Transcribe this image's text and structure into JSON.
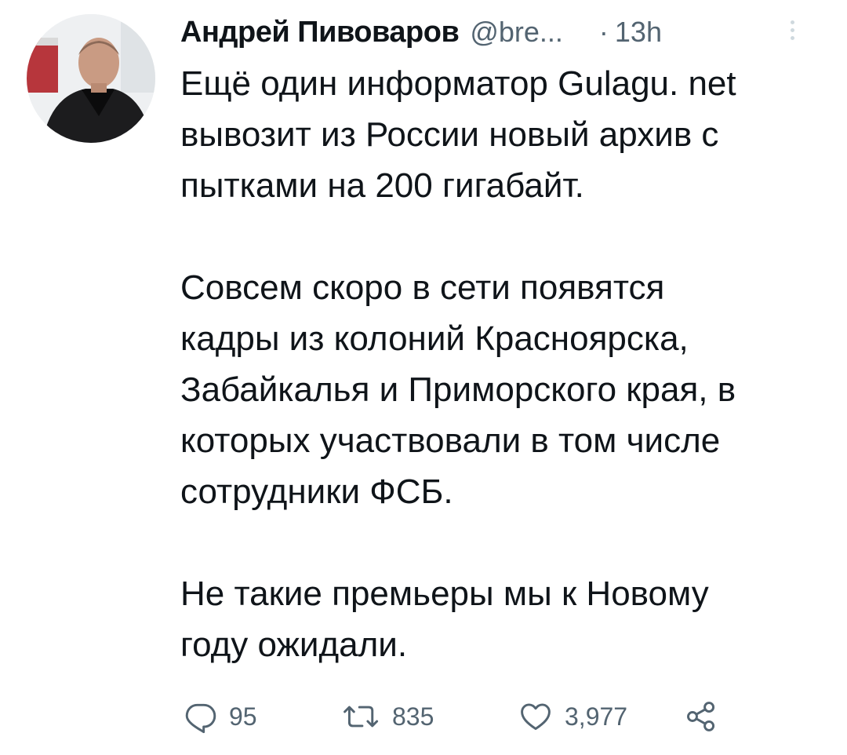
{
  "tweet": {
    "author": {
      "display_name": "Андрей Пивоваров",
      "handle": "@bre...",
      "avatar_icon": "avatar-photo"
    },
    "separator": "·",
    "time": "13h",
    "more_icon": "more-vertical-icon",
    "text": {
      "paragraphs": [
        [
          "Ещё один информатор Gulagu. net",
          "вывозит из России новый архив с",
          "пытками на 200 гигабайт."
        ],
        [
          "Совсем скоро в сети появятся",
          "кадры из колоний Красноярска,",
          "Забайкалья и Приморского края, в",
          "которых участвовали в том числе",
          "сотрудники ФСБ."
        ],
        [
          "Не такие премьеры мы к Новому",
          "году ожидали."
        ]
      ]
    },
    "actions": {
      "reply": {
        "icon": "reply-icon",
        "count": "95"
      },
      "retweet": {
        "icon": "retweet-icon",
        "count": "835"
      },
      "like": {
        "icon": "heart-icon",
        "count": "3,977"
      },
      "share": {
        "icon": "share-icon"
      }
    }
  },
  "colors": {
    "text_primary": "#0f1419",
    "text_secondary": "#536471",
    "background": "#ffffff"
  }
}
